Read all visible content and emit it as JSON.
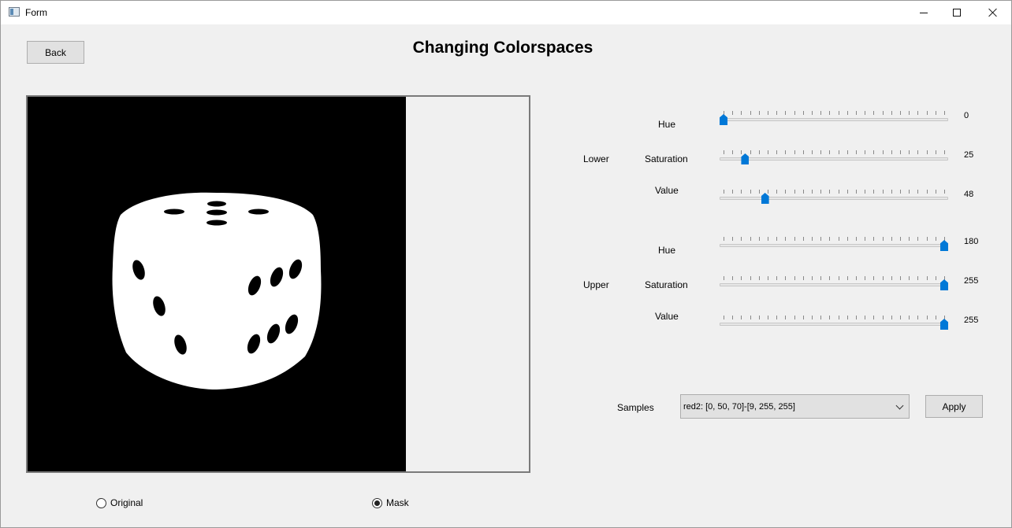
{
  "window": {
    "title": "Form"
  },
  "header": {
    "back_label": "Back",
    "title": "Changing Colorspaces"
  },
  "view": {
    "original_label": "Original",
    "mask_label": "Mask",
    "selected": "Mask"
  },
  "ranges": {
    "lower_label": "Lower",
    "upper_label": "Upper",
    "lower": [
      {
        "label": "Hue",
        "value": "0",
        "fraction": 0.0
      },
      {
        "label": "Saturation",
        "value": "25",
        "fraction": 0.098
      },
      {
        "label": "Value",
        "value": "48",
        "fraction": 0.188
      }
    ],
    "upper": [
      {
        "label": "Hue",
        "value": "180",
        "fraction": 1.0
      },
      {
        "label": "Saturation",
        "value": "255",
        "fraction": 1.0
      },
      {
        "label": "Value",
        "value": "255",
        "fraction": 1.0
      }
    ]
  },
  "samples": {
    "label": "Samples",
    "selected": "red2: [0, 50, 70]-[9, 255, 255]",
    "apply_label": "Apply"
  },
  "colors": {
    "accent": "#0078d7",
    "mask_background": "#000000",
    "mask_foreground": "#ffffff"
  },
  "icons": {
    "window": "app-window-icon",
    "minimize": "minimize-icon",
    "maximize": "maximize-icon",
    "close": "close-icon",
    "dropdown": "chevron-down-icon"
  }
}
